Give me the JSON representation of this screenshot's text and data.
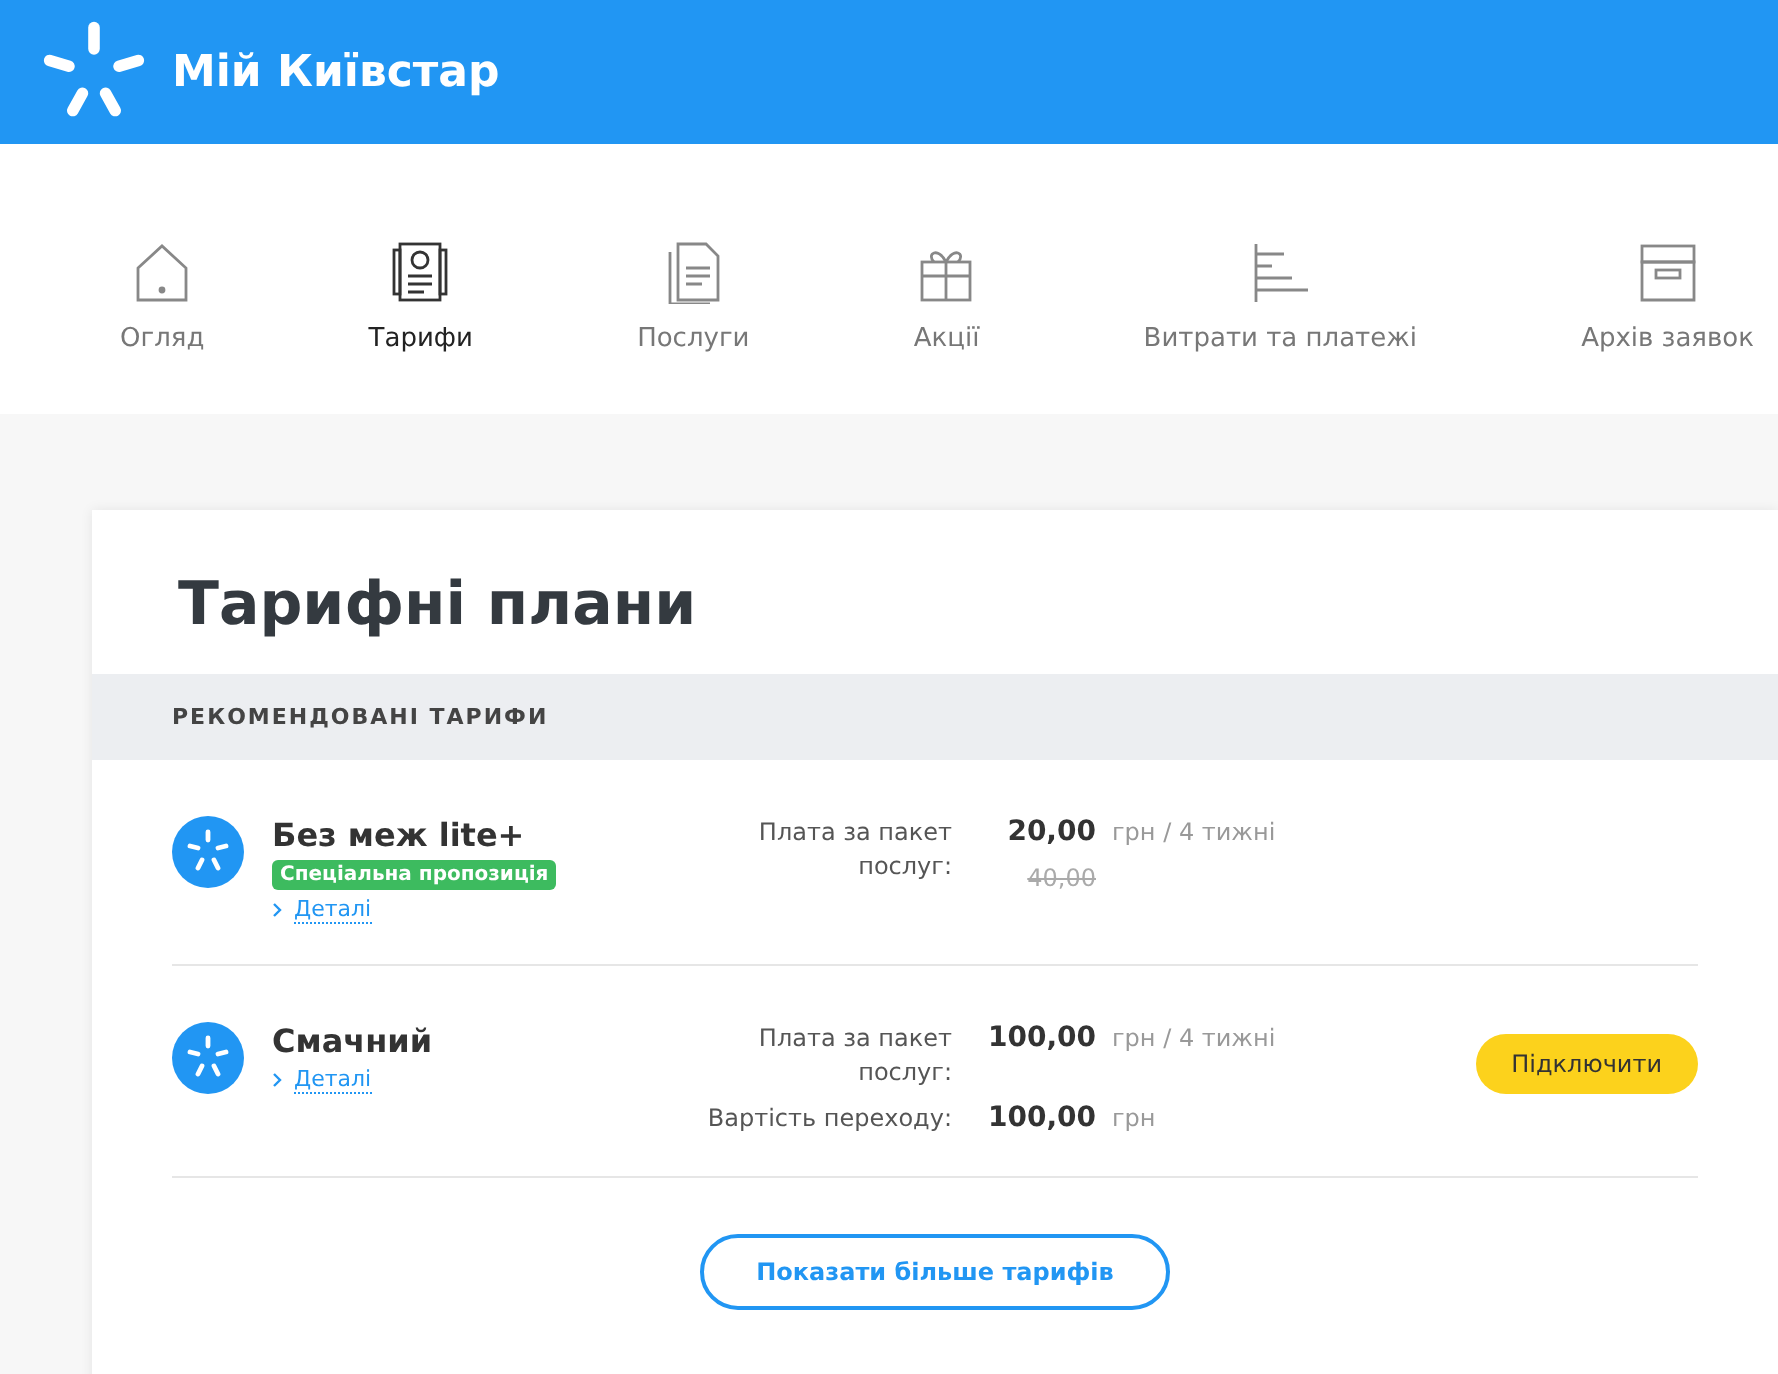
{
  "header": {
    "title": "Мій Київстар"
  },
  "nav": [
    {
      "label": "Огляд",
      "selected": false
    },
    {
      "label": "Тарифи",
      "selected": true
    },
    {
      "label": "Послуги",
      "selected": false
    },
    {
      "label": "Акції",
      "selected": false
    },
    {
      "label": "Витрати та платежі",
      "selected": false
    },
    {
      "label": "Архів заявок",
      "selected": false
    }
  ],
  "card": {
    "title": "Тарифні плани",
    "section": "РЕКОМЕНДОВАНІ ТАРИФИ",
    "tariffs": [
      {
        "name": "Без меж lite+",
        "badge": "Спеціальна пропозиція",
        "details": "Деталі",
        "prices": [
          {
            "label": "Плата за пакет послуг:",
            "amount": "20,00",
            "unit": "грн / 4 тижні",
            "old": "40,00"
          }
        ]
      },
      {
        "name": "Смачний",
        "details": "Деталі",
        "button": "Підключити",
        "prices": [
          {
            "label": "Плата за пакет послуг:",
            "amount": "100,00",
            "unit": "грн / 4 тижні"
          },
          {
            "label": "Вартість переходу:",
            "amount": "100,00",
            "unit": "грн"
          }
        ]
      }
    ],
    "more": "Показати більше тарифів"
  }
}
